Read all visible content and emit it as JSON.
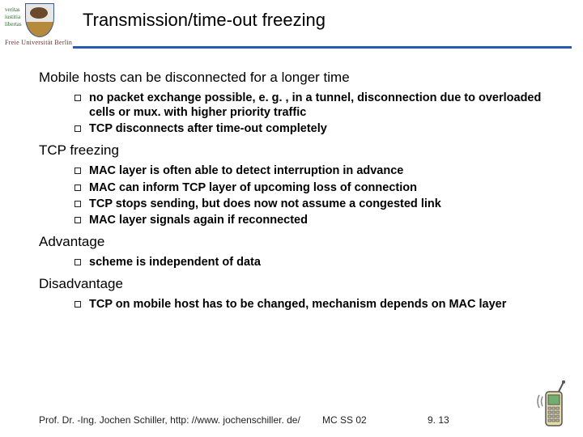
{
  "header": {
    "motto_lines": "veritas\niustitia\nlibertas",
    "university": "Freie Universität Berlin",
    "title": "Transmission/time-out freezing"
  },
  "sections": [
    {
      "heading": "Mobile hosts can be disconnected for a longer time",
      "items": [
        "no packet exchange possible, e. g. , in a tunnel, disconnection due to overloaded cells or mux. with higher priority traffic",
        "TCP disconnects after time-out completely"
      ]
    },
    {
      "heading": "TCP freezing",
      "items": [
        "MAC layer is often able to detect interruption in advance",
        "MAC can inform TCP layer of upcoming loss of connection",
        "TCP stops sending, but does now not assume a congested link",
        "MAC layer signals again if reconnected"
      ]
    },
    {
      "heading": "Advantage",
      "items": [
        "scheme is independent of data"
      ]
    },
    {
      "heading": "Disadvantage",
      "items": [
        "TCP on mobile host has to be changed, mechanism depends on MAC layer"
      ]
    }
  ],
  "footer": {
    "author": "Prof. Dr. -Ing. Jochen Schiller, http: //www. jochenschiller. de/",
    "course": "MC SS 02",
    "page": "9. 13"
  }
}
